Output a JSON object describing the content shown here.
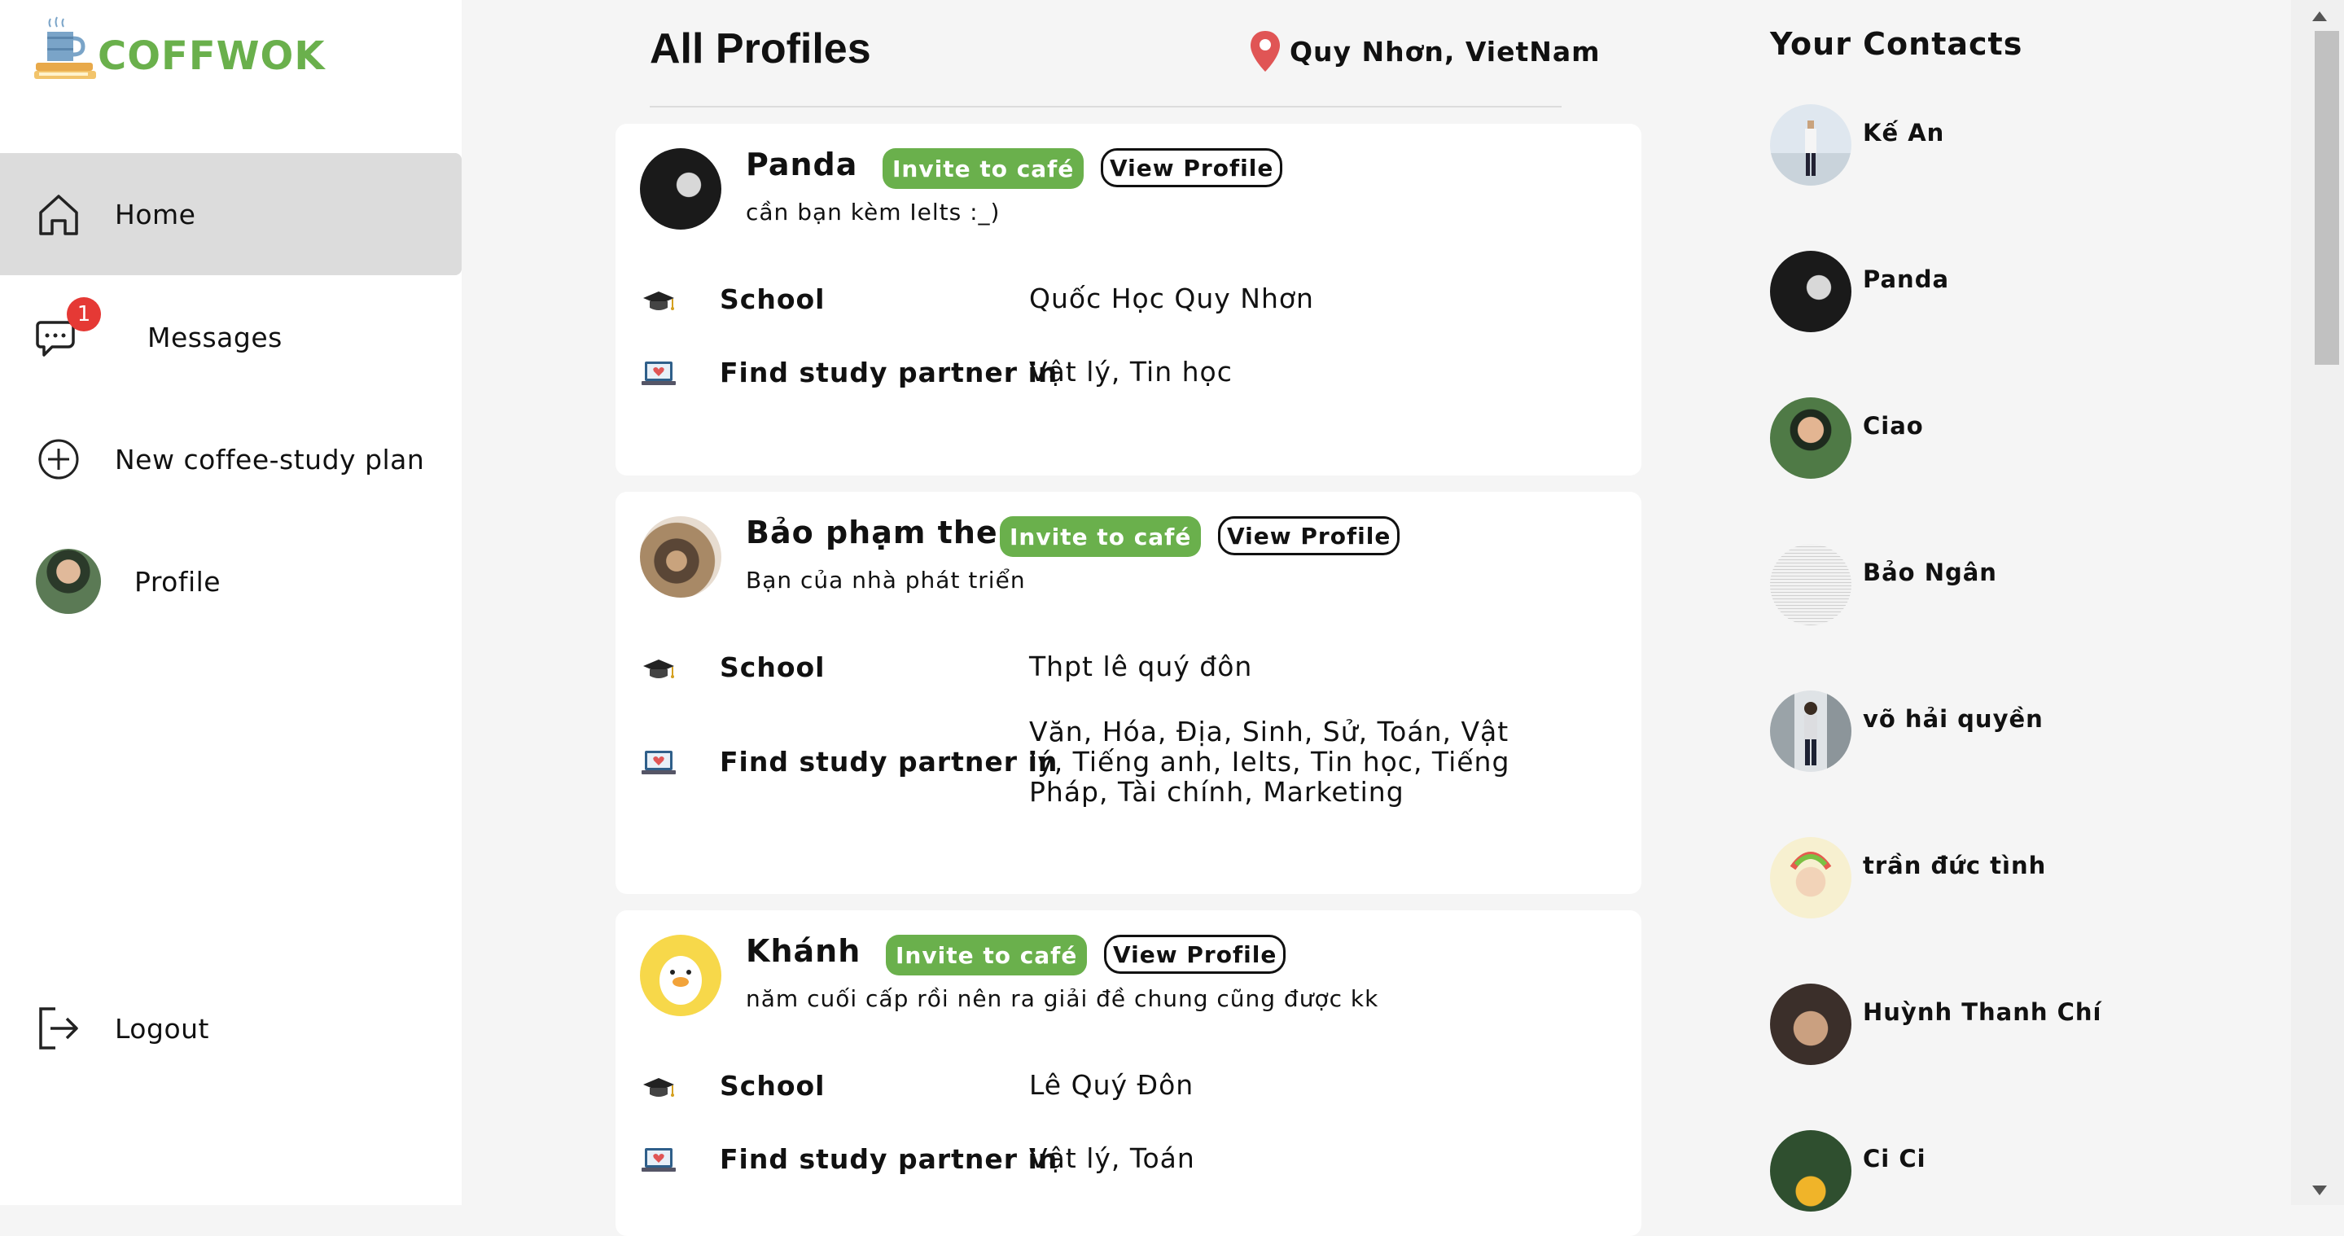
{
  "app": {
    "brand": "COFFWOK"
  },
  "sidebar": {
    "items": [
      {
        "label": "Home",
        "icon": "home-icon",
        "active": true
      },
      {
        "label": "Messages",
        "icon": "chat-icon",
        "badge": "1"
      },
      {
        "label": "New coffee-study plan",
        "icon": "plus-circle-icon"
      },
      {
        "label": "Profile",
        "icon": "avatar"
      }
    ],
    "logout": {
      "label": "Logout",
      "icon": "logout-icon"
    }
  },
  "main": {
    "title": "All Profiles",
    "location": "Quy Nhơn, VietNam",
    "invite_label": "Invite to café",
    "view_label": "View Profile",
    "school_key": "School",
    "study_key": "Find study partner in",
    "profiles": [
      {
        "name": "Panda",
        "bio": "cần bạn kèm Ielts :_)",
        "school": "Quốc Học Quy Nhơn",
        "subjects": "Vật lý, Tin học"
      },
      {
        "name": "Bảo phạm the",
        "bio": "Bạn của nhà phát triển",
        "school": "Thpt lê quý đôn",
        "subjects": "Văn, Hóa, Địa, Sinh, Sử, Toán, Vật lý, Tiếng anh, Ielts, Tin học, Tiếng Pháp, Tài chính, Marketing"
      },
      {
        "name": "Khánh",
        "bio": "năm cuối cấp rồi nên ra giải đề chung cũng được kk",
        "school": "Lê Quý Đôn",
        "subjects": "Vật lý, Toán"
      }
    ]
  },
  "contacts": {
    "title": "Your Contacts",
    "items": [
      "Kế An",
      "Panda",
      "Ciao",
      "Bảo Ngân",
      "võ hải quyền",
      "trần đức tình",
      "Huỳnh Thanh Chí",
      "Ci Ci"
    ]
  },
  "colors": {
    "accent": "#6ab04c",
    "badge": "#e53935",
    "active_bg": "#dcdcdc",
    "pin": "#e05555"
  }
}
